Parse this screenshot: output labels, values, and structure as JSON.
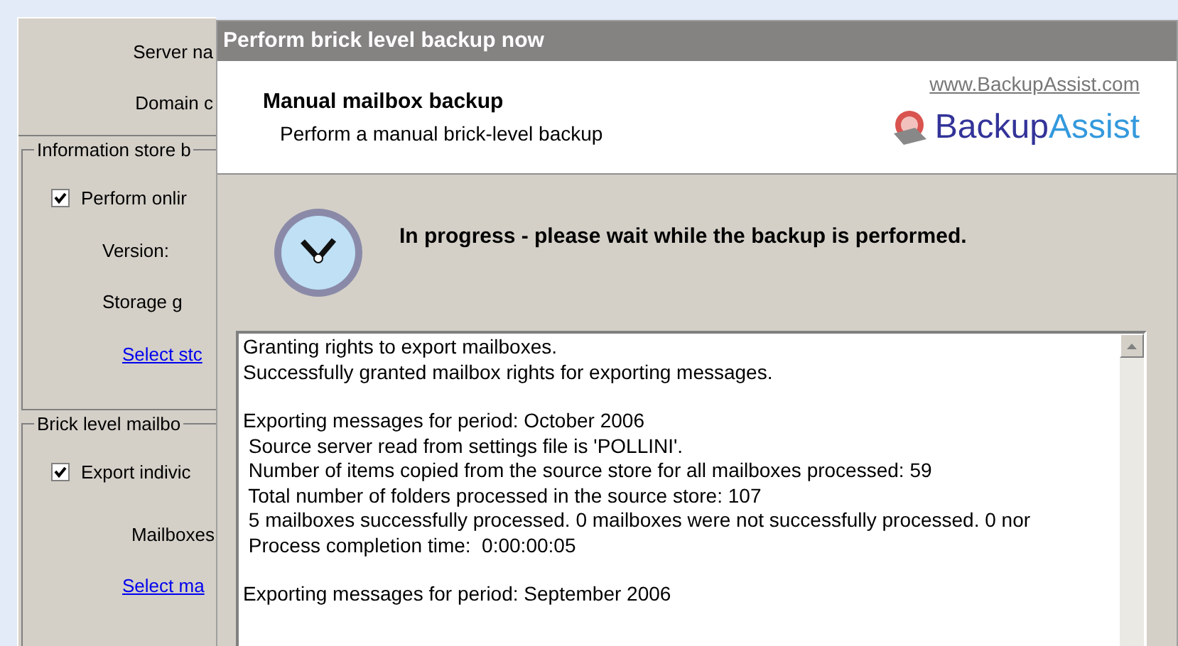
{
  "background_window": {
    "server_label": "Server na",
    "domain_label": "Domain c",
    "groups": [
      {
        "legend": "Information store b",
        "checkbox": {
          "label": "Perform onlir",
          "checked": true
        },
        "fields": [
          "Version:",
          "Storage g"
        ],
        "link": "Select stc"
      },
      {
        "legend": "Brick level mailbo",
        "checkbox": {
          "label": "Export indivic",
          "checked": true
        },
        "fields": [
          "Mailboxes"
        ],
        "link": "Select ma"
      }
    ]
  },
  "dialog": {
    "title": "Perform brick level backup now",
    "heading": "Manual mailbox backup",
    "subheading": "Perform a manual brick-level backup",
    "website": "www.BackupAssist.com",
    "logo": {
      "part_1": "Backup",
      "part_2": "Assist"
    },
    "status": "In progress - please wait while the backup is performed.",
    "log": [
      [
        "Granting rights to export mailboxes.",
        "Successfully granted mailbox rights for exporting messages."
      ],
      [
        "Exporting messages for period: October 2006",
        " Source server read from settings file is 'POLLINI'.",
        " Number of items copied from the source store for all mailboxes processed: 59",
        " Total number of folders processed in the source store: 107",
        " 5 mailboxes successfully processed. 0 mailboxes were not successfully processed. 0 nor",
        " Process completion time:  0:00:00:05"
      ],
      [
        "Exporting messages for period: September 2006"
      ]
    ]
  }
}
